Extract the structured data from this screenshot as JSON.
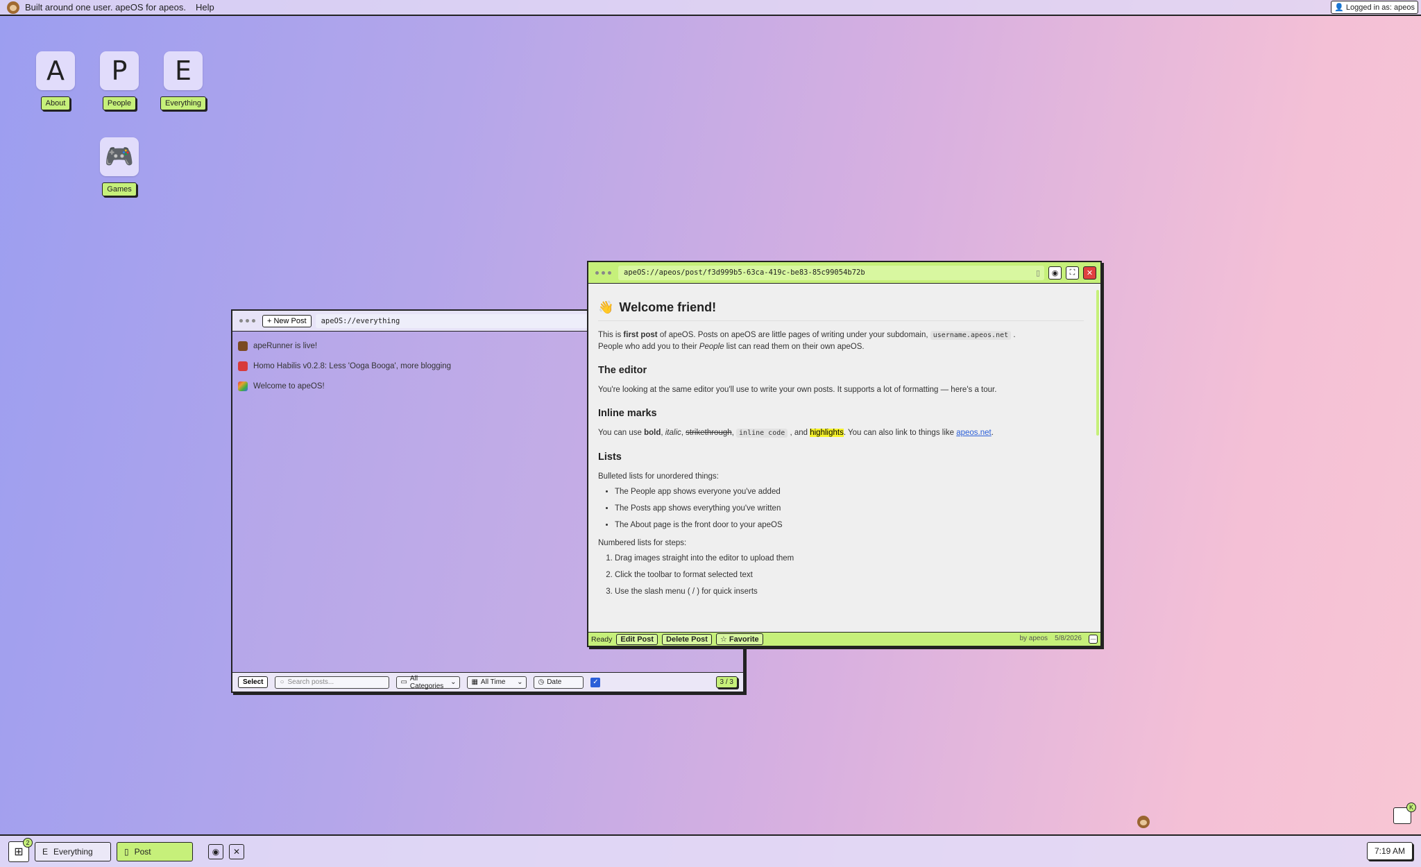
{
  "menubar": {
    "brand": "Built around one user. apeOS for apeos.",
    "help": "Help",
    "login": "Logged in as: apeos"
  },
  "desktop": {
    "icons": [
      {
        "glyph": "A",
        "label": "About"
      },
      {
        "glyph": "P",
        "label": "People"
      },
      {
        "glyph": "E",
        "label": "Everything"
      },
      {
        "glyph": "🎮",
        "label": "Games"
      }
    ]
  },
  "everything_window": {
    "new_post": "+ New Post",
    "address": "apeOS://everything",
    "posts": [
      {
        "icon": "runner-icon",
        "color": "#7a4a22",
        "title": "apeRunner is live!"
      },
      {
        "icon": "robot-icon",
        "color": "#d83a3a",
        "title": "Homo Habilis v0.2.8: Less 'Ooga Booga', more blogging"
      },
      {
        "icon": "rainbow-icon",
        "color": "#e8a030",
        "title": "Welcome to apeOS!"
      }
    ],
    "footer": {
      "select": "Select",
      "search_placeholder": "Search posts...",
      "category": "All Categories",
      "time": "All Time",
      "sort": "Date",
      "count": "3 / 3"
    }
  },
  "post_window": {
    "address": "apeOS://apeos/post/f3d999b5-63ca-419c-be83-85c99054b72b",
    "title": "Welcome friend!",
    "intro": {
      "p1a": "This is ",
      "p1b": "first post",
      "p1c": " of apeOS. Posts on apeOS are little pages of writing under your subdomain, ",
      "p1code": "username.apeos.net",
      "p1d": " .",
      "p2a": "People who add you to their ",
      "p2b": "People",
      "p2c": " list can read them on their own apeOS."
    },
    "editor_heading": "The editor",
    "editor_text": "You're looking at the same editor you'll use to write your own posts. It supports a lot of formatting — here's a tour.",
    "inline_heading": "Inline marks",
    "inline": {
      "a": "You can use ",
      "bold": "bold",
      "sep1": ", ",
      "italic": "italic",
      "sep2": ", ",
      "strike": "strikethrough",
      "sep3": ", ",
      "code": "inline code",
      "sep4": " , and ",
      "highlight": "highlights",
      "b": ". You can also link to things like ",
      "link": "apeos.net",
      "c": "."
    },
    "lists_heading": "Lists",
    "bulleted_intro": "Bulleted lists for unordered things:",
    "bullets": [
      "The People app shows everyone you've added",
      "The Posts app shows everything you've written",
      "The About page is the front door to your apeOS"
    ],
    "numbered_intro": "Numbered lists for steps:",
    "numbered": [
      "Drag images straight into the editor to upload them",
      "Click the toolbar to format selected text",
      "Use the slash menu ( / ) for quick inserts"
    ],
    "footer": {
      "status": "Ready",
      "edit": "Edit Post",
      "delete": "Delete Post",
      "favorite": "☆ Favorite",
      "author": "by apeos",
      "date": "5/8/2026"
    }
  },
  "taskbar": {
    "badge": "2",
    "items": [
      {
        "glyph": "E",
        "label": "Everything"
      },
      {
        "glyph": "▯",
        "label": "Post"
      }
    ],
    "clock": "7:19 AM",
    "tray_badge": "K"
  },
  "colors": {
    "accent": "#c6f07a",
    "close": "#e04040",
    "link": "#2b5fd8"
  }
}
